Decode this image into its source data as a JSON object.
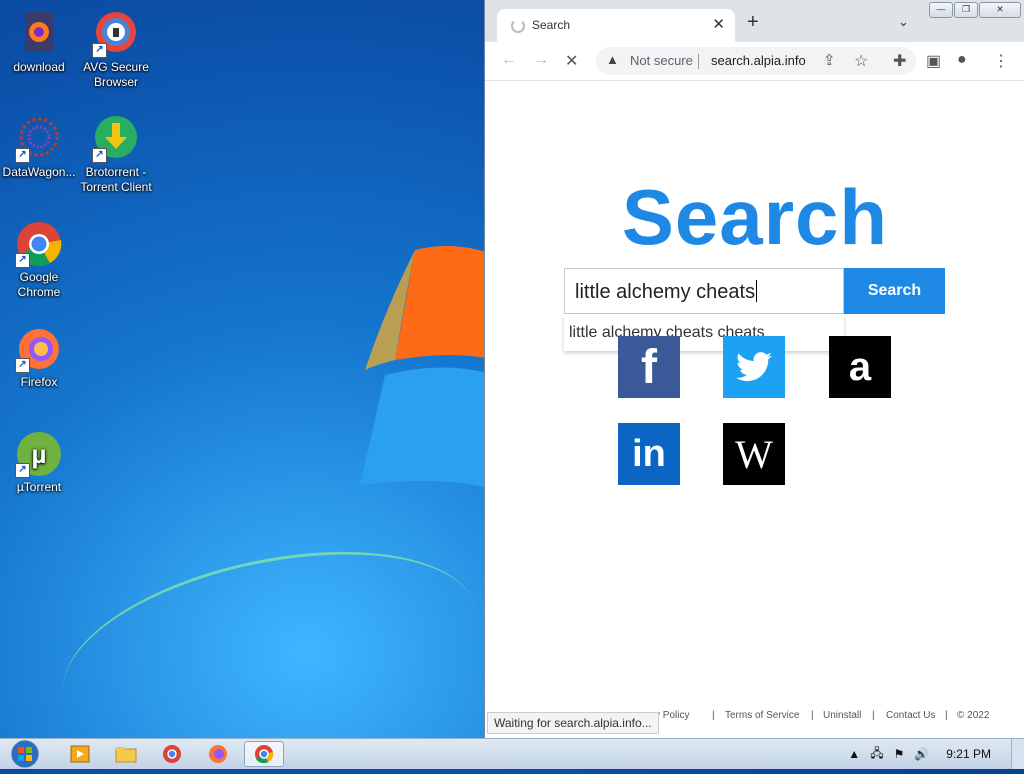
{
  "desktop": {
    "icons": [
      {
        "label": "download",
        "icon": "firefox-file-icon"
      },
      {
        "label": "AVG Secure Browser",
        "icon": "avg-browser-icon"
      },
      {
        "label": "DataWagon...",
        "icon": "datawagon-icon"
      },
      {
        "label": "Brotorrent - Torrent Client",
        "icon": "brotorrent-icon"
      },
      {
        "label": "Google Chrome",
        "icon": "chrome-icon"
      },
      {
        "label": "Firefox",
        "icon": "firefox-icon"
      },
      {
        "label": "µTorrent",
        "icon": "utorrent-icon"
      }
    ]
  },
  "browser": {
    "tab": {
      "title": "Search"
    },
    "toolbar": {
      "security_label": "Not secure",
      "url": "search.alpia.info"
    },
    "page": {
      "heading": "Search",
      "search_value": "little alchemy cheats",
      "search_button": "Search",
      "suggestion": "little alchemy cheats cheats",
      "social": [
        {
          "name": "facebook",
          "glyph": "f",
          "color": "#3b5998"
        },
        {
          "name": "twitter",
          "glyph": "🐦",
          "color": "#1da1f2"
        },
        {
          "name": "amazon",
          "glyph": "a",
          "color": "#000000"
        },
        {
          "name": "linkedin",
          "glyph": "in",
          "color": "#0a66c2"
        },
        {
          "name": "wikipedia",
          "glyph": "W",
          "color": "#000000"
        }
      ],
      "footer": {
        "privacy": "cy Policy",
        "terms": "Terms of Service",
        "uninstall": "Uninstall",
        "contact": "Contact Us",
        "copyright": "© 2022"
      }
    },
    "status_text": "Waiting for search.alpia.info..."
  },
  "taskbar": {
    "clock": "9:21 PM"
  },
  "colors": {
    "accent": "#1e88e5"
  }
}
